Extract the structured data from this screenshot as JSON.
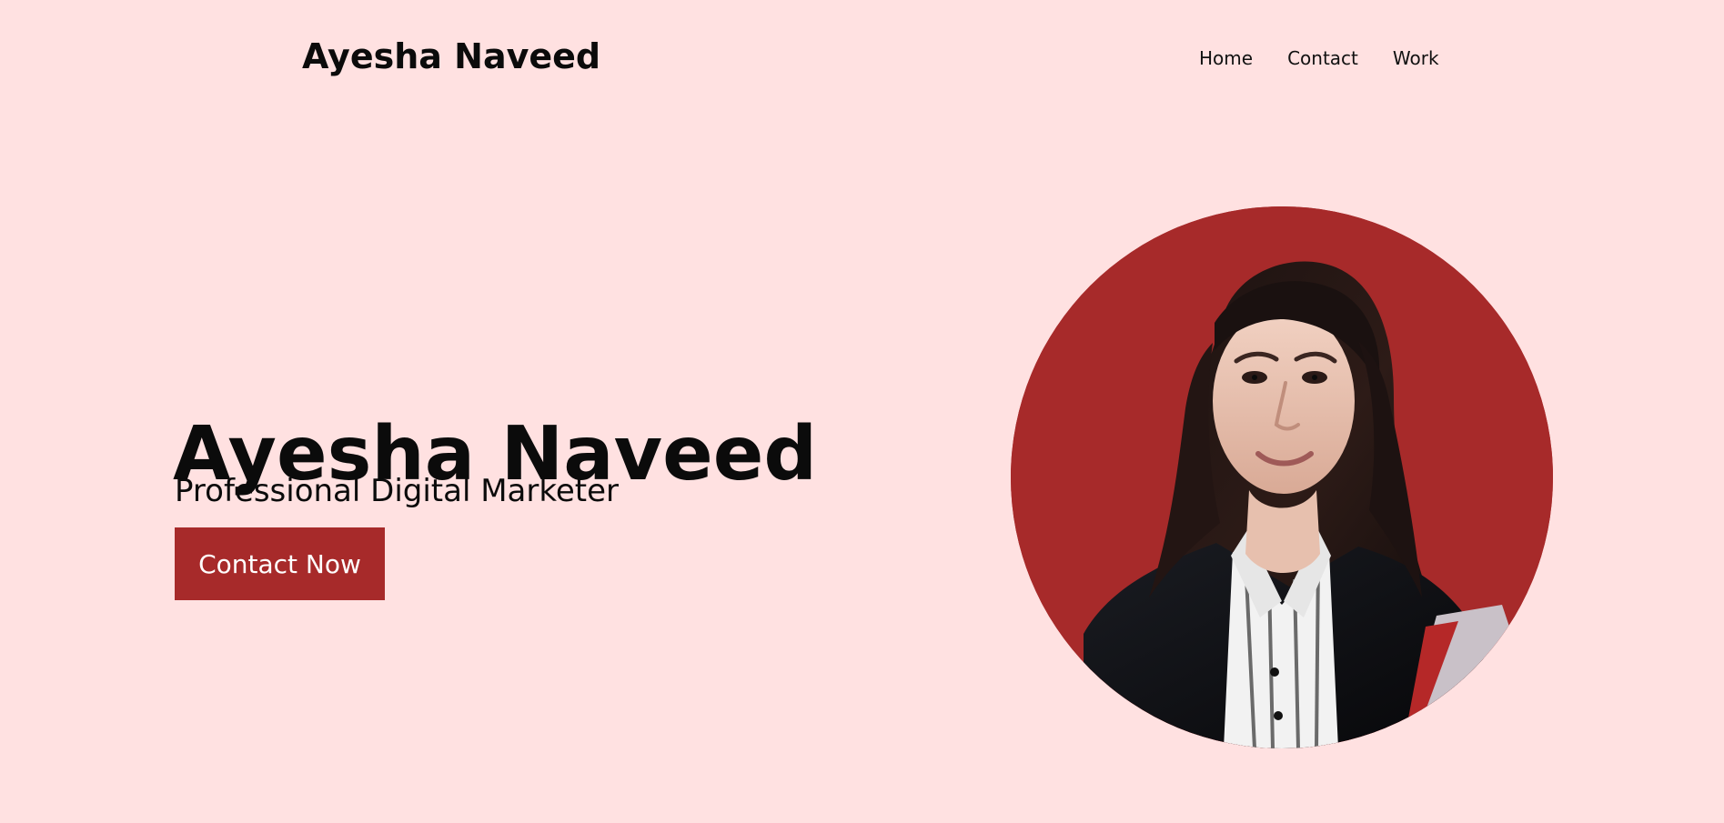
{
  "header": {
    "brand": "Ayesha Naveed",
    "nav": [
      {
        "label": "Home"
      },
      {
        "label": "Contact"
      },
      {
        "label": "Work"
      }
    ]
  },
  "hero": {
    "title": "Ayesha Naveed",
    "subtitle": "Professional Digital Marketer",
    "cta_label": "Contact Now"
  },
  "colors": {
    "background": "#ffe1e1",
    "accent": "#a72a2a",
    "text": "#0b0b0b",
    "button_text": "#ffffff"
  },
  "images": {
    "profile_photo": "profile-photo"
  }
}
